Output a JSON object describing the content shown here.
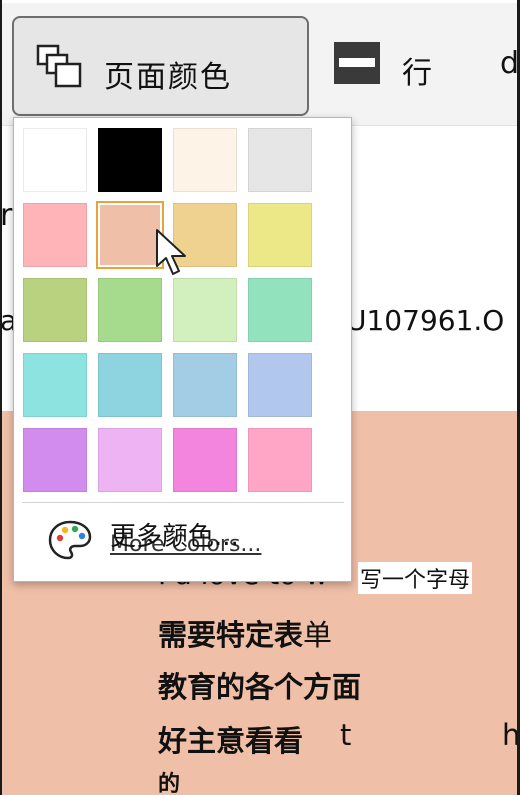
{
  "toolbar": {
    "page_color_label": "页面颜色",
    "page_color_icon": "page-color-icon",
    "rows_label": "行",
    "rows_icon": "rows-icon",
    "truncated_text": "d"
  },
  "background": {
    "fragment_r": "r",
    "fragment_a": "a",
    "fragment_id": "U107961.O",
    "line1_en": "I'd love to w",
    "line1_zh": "写一个字母",
    "line2_bold": "需要特定表",
    "line2_light": "单",
    "line3": "教育的各个方面",
    "line4_zh": "好主意看看",
    "line4_t": "t",
    "line4_h": "h",
    "line5": "的",
    "highlight_color": "#f0bfa8"
  },
  "dropdown": {
    "swatches": [
      {
        "color": "#ffffff"
      },
      {
        "color": "#000000"
      },
      {
        "color": "#fdf3e6"
      },
      {
        "color": "#e6e6e6"
      },
      {
        "color": "#ffb4b8"
      },
      {
        "color": "#f0bfa8",
        "selected": true
      },
      {
        "color": "#efd28f"
      },
      {
        "color": "#ece887"
      },
      {
        "color": "#b8d280"
      },
      {
        "color": "#a6da8c"
      },
      {
        "color": "#d1f0be"
      },
      {
        "color": "#92e2bd"
      },
      {
        "color": "#8de3e0"
      },
      {
        "color": "#8dd3e0"
      },
      {
        "color": "#a3cde4"
      },
      {
        "color": "#b2c7ee"
      },
      {
        "color": "#d18ced"
      },
      {
        "color": "#edb3f3"
      },
      {
        "color": "#f485de"
      },
      {
        "color": "#ffa6c6"
      }
    ],
    "more_colors_zh": "更多颜色...",
    "more_colors_en": "More Colors...",
    "palette_icon": "palette-icon",
    "selected_outline_color": "#e8a33a"
  },
  "cursor_icon": "mouse-pointer-icon"
}
